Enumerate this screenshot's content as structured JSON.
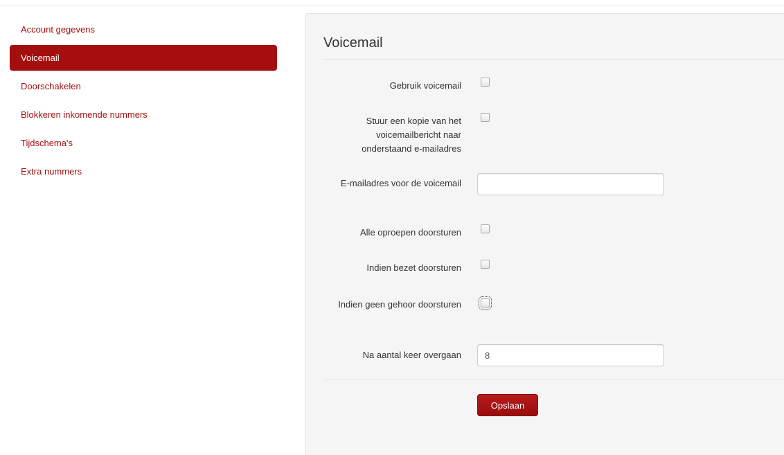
{
  "sidebar": {
    "items": [
      {
        "label": "Account gegevens",
        "active": false
      },
      {
        "label": "Voicemail",
        "active": true
      },
      {
        "label": "Doorschakelen",
        "active": false
      },
      {
        "label": "Blokkeren inkomende nummers",
        "active": false
      },
      {
        "label": "Tijdschema's",
        "active": false
      },
      {
        "label": "Extra nummers",
        "active": false
      }
    ]
  },
  "form": {
    "title": "Voicemail",
    "use_voicemail": {
      "label": "Gebruik voicemail",
      "checked": false
    },
    "send_copy": {
      "label": "Stuur een kopie van het voicemailbericht naar onderstaand e-mailadres",
      "checked": false
    },
    "email": {
      "label": "E-mailadres voor de voicemail",
      "value": "",
      "placeholder": ""
    },
    "forward_all": {
      "label": "Alle oproepen doorsturen",
      "checked": false
    },
    "forward_busy": {
      "label": "Indien bezet doorsturen",
      "checked": false
    },
    "forward_no_answer": {
      "label": "Indien geen gehoor doorsturen",
      "checked": false
    },
    "ring_count": {
      "label": "Na aantal keer overgaan",
      "value": "8"
    },
    "save_label": "Opslaan"
  },
  "colors": {
    "accent": "#a50e0e",
    "panel_background": "#f5f5f5"
  }
}
